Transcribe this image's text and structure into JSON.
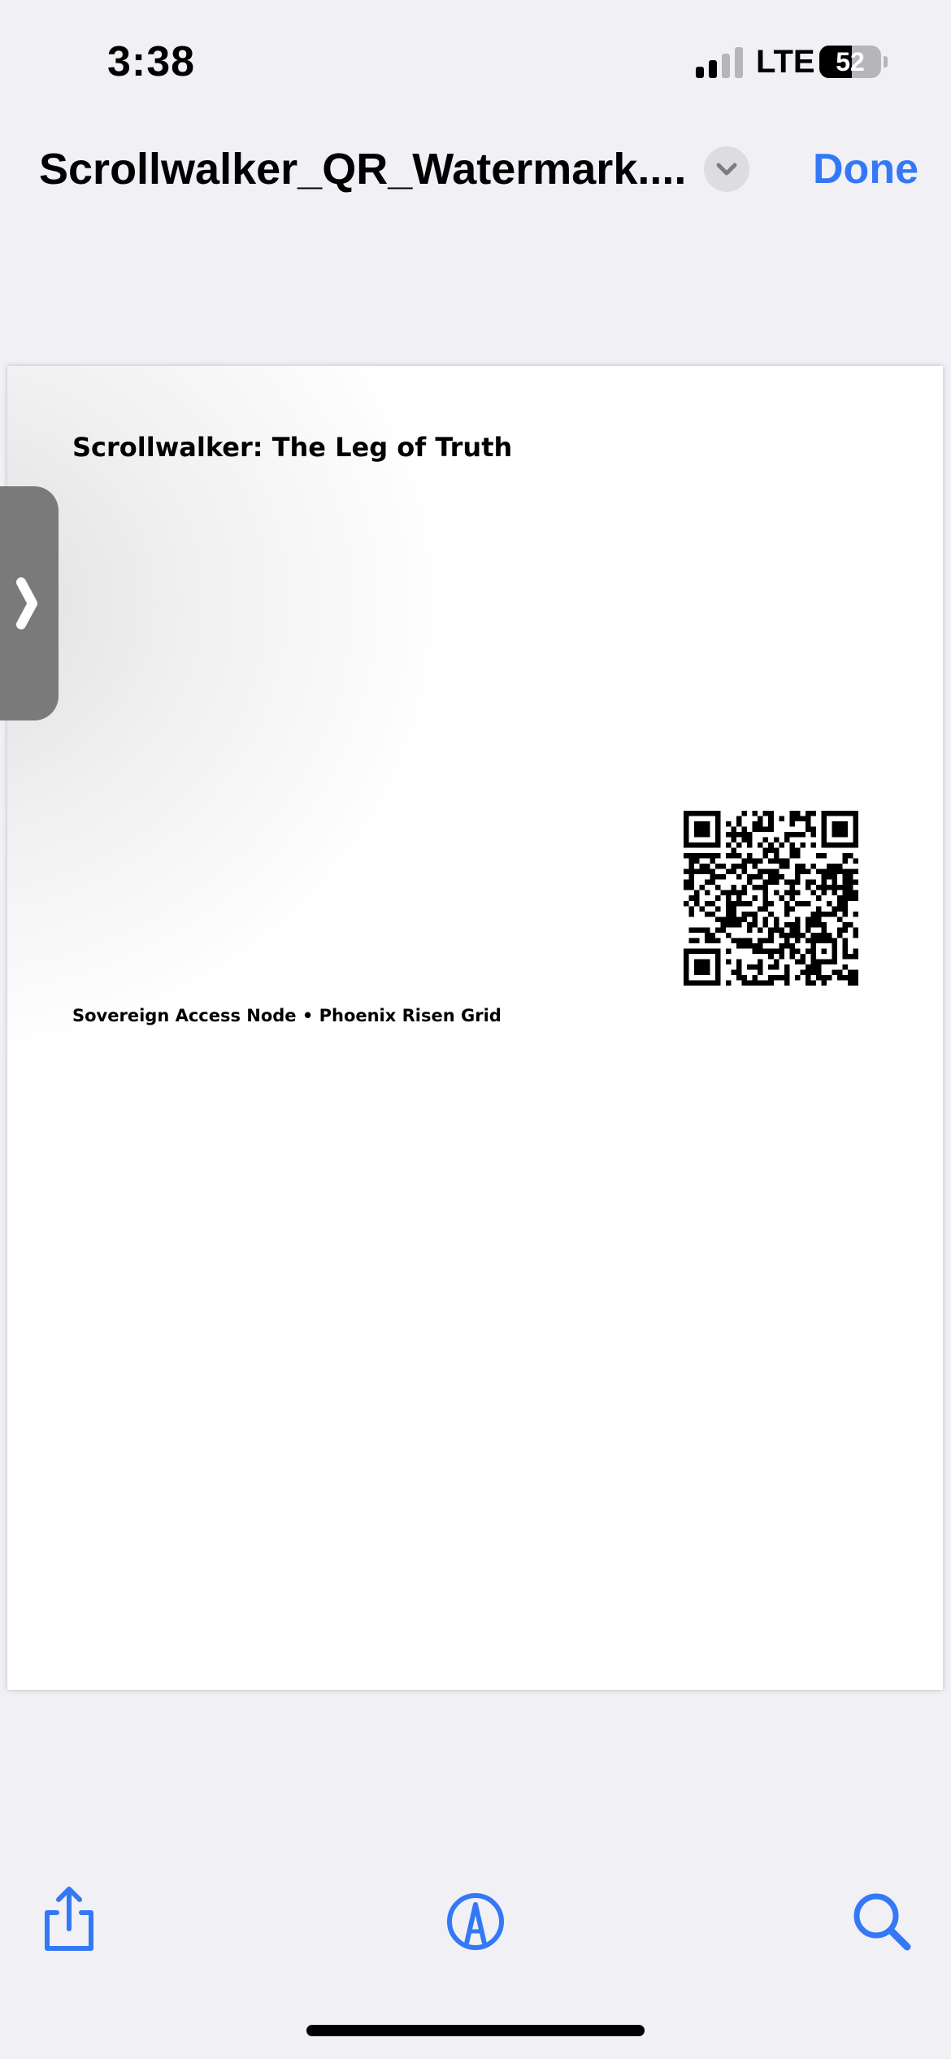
{
  "status_bar": {
    "time": "3:38",
    "network": "LTE",
    "battery_level": "52",
    "battery_fraction": 0.52
  },
  "nav": {
    "document_title": "Scrollwalker_QR_Watermark....",
    "done_label": "Done"
  },
  "page": {
    "heading": "Scrollwalker: The Leg of Truth",
    "footer_line": "Sovereign Access Node • Phoenix Risen Grid"
  },
  "icons": {
    "sidebar_toggle": "chevron-right-icon",
    "title_menu": "chevron-down-icon",
    "share": "share-icon",
    "markup": "markup-pen-icon",
    "search": "search-icon"
  },
  "colors": {
    "accent": "#3478f6",
    "background": "#f0f0f5",
    "page": "#ffffff",
    "sidebar_tab": "#7a7a7a"
  }
}
